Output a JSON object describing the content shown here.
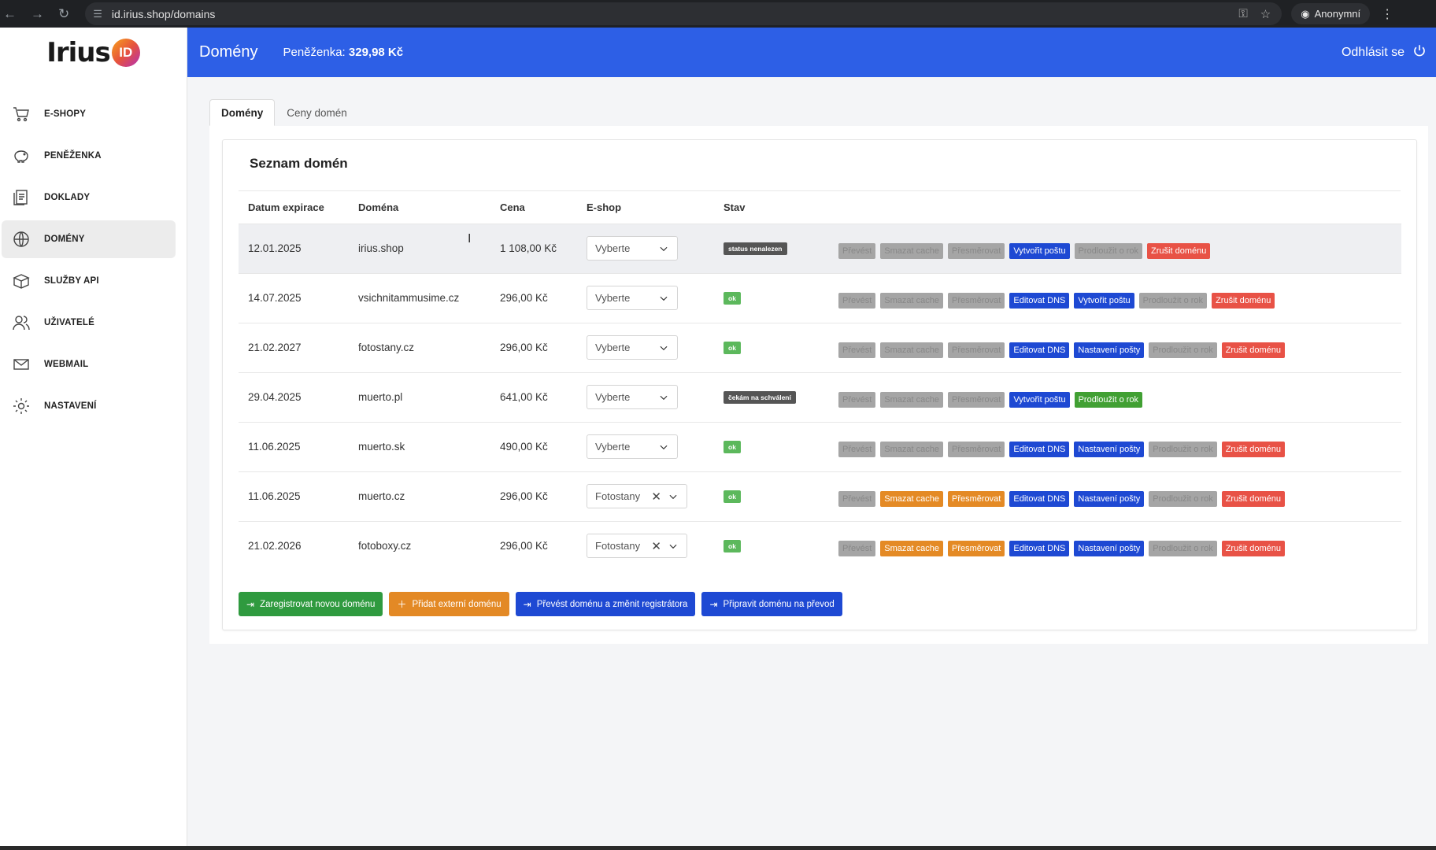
{
  "browser": {
    "url": "id.irius.shop/domains",
    "profile": "Anonymní"
  },
  "logo": {
    "word": "Irius",
    "badge": "ID"
  },
  "sidebar": {
    "items": [
      {
        "label": "E-SHOPY",
        "icon": "cart-icon"
      },
      {
        "label": "PENĚŽENKA",
        "icon": "piggy-bank-icon"
      },
      {
        "label": "DOKLADY",
        "icon": "documents-icon"
      },
      {
        "label": "DOMÉNY",
        "icon": "globe-icon"
      },
      {
        "label": "SLUŽBY API",
        "icon": "box-icon"
      },
      {
        "label": "UŽIVATELÉ",
        "icon": "users-icon"
      },
      {
        "label": "WEBMAIL",
        "icon": "mail-icon"
      },
      {
        "label": "NASTAVENÍ",
        "icon": "gear-icon"
      }
    ]
  },
  "header": {
    "title": "Domény",
    "wallet_label": "Peněženka:",
    "wallet_value": "329,98 Kč",
    "logout": "Odhlásit se"
  },
  "tabs": [
    "Domény",
    "Ceny domén"
  ],
  "card": {
    "title": "Seznam domén",
    "columns": [
      "Datum expirace",
      "Doména",
      "Cena",
      "E-shop",
      "Stav"
    ],
    "rows": [
      {
        "date": "12.01.2025",
        "domain": "irius.shop",
        "price": "1 108,00 Kč",
        "eshop": "Vyberte",
        "status": "status nenalezen",
        "actions": [
          "Převést",
          "Smazat cache",
          "Přesměrovat",
          "Vytvořit poštu",
          "Prodloužit o rok",
          "Zrušit doménu"
        ]
      },
      {
        "date": "14.07.2025",
        "domain": "vsichnitammusime.cz",
        "price": "296,00 Kč",
        "eshop": "Vyberte",
        "status": "ok",
        "actions": [
          "Převést",
          "Smazat cache",
          "Přesměrovat",
          "Editovat DNS",
          "Vytvořit poštu",
          "Prodloužit o rok",
          "Zrušit doménu"
        ]
      },
      {
        "date": "21.02.2027",
        "domain": "fotostany.cz",
        "price": "296,00 Kč",
        "eshop": "Vyberte",
        "status": "ok",
        "actions": [
          "Převést",
          "Smazat cache",
          "Přesměrovat",
          "Editovat DNS",
          "Nastavení pošty",
          "Prodloužit o rok",
          "Zrušit doménu"
        ]
      },
      {
        "date": "29.04.2025",
        "domain": "muerto.pl",
        "price": "641,00 Kč",
        "eshop": "Vyberte",
        "status": "čekám na schválení",
        "actions": [
          "Převést",
          "Smazat cache",
          "Přesměrovat",
          "Vytvořit poštu",
          "Prodloužit o rok"
        ]
      },
      {
        "date": "11.06.2025",
        "domain": "muerto.sk",
        "price": "490,00 Kč",
        "eshop": "Vyberte",
        "status": "ok",
        "actions": [
          "Převést",
          "Smazat cache",
          "Přesměrovat",
          "Editovat DNS",
          "Nastavení pošty",
          "Prodloužit o rok",
          "Zrušit doménu"
        ]
      },
      {
        "date": "11.06.2025",
        "domain": "muerto.cz",
        "price": "296,00 Kč",
        "eshop": "Fotostany",
        "status": "ok",
        "actions": [
          "Převést",
          "Smazat cache",
          "Přesměrovat",
          "Editovat DNS",
          "Nastavení pošty",
          "Prodloužit o rok",
          "Zrušit doménu"
        ]
      },
      {
        "date": "21.02.2026",
        "domain": "fotoboxy.cz",
        "price": "296,00 Kč",
        "eshop": "Fotostany",
        "status": "ok",
        "actions": [
          "Převést",
          "Smazat cache",
          "Přesměrovat",
          "Editovat DNS",
          "Nastavení pošty",
          "Prodloužit o rok",
          "Zrušit doménu"
        ]
      }
    ],
    "bottom_buttons": [
      "Zaregistrovat novou doménu",
      "Přidat externí doménu",
      "Převést doménu a změnit registrátora",
      "Připravit doménu na převod"
    ]
  }
}
